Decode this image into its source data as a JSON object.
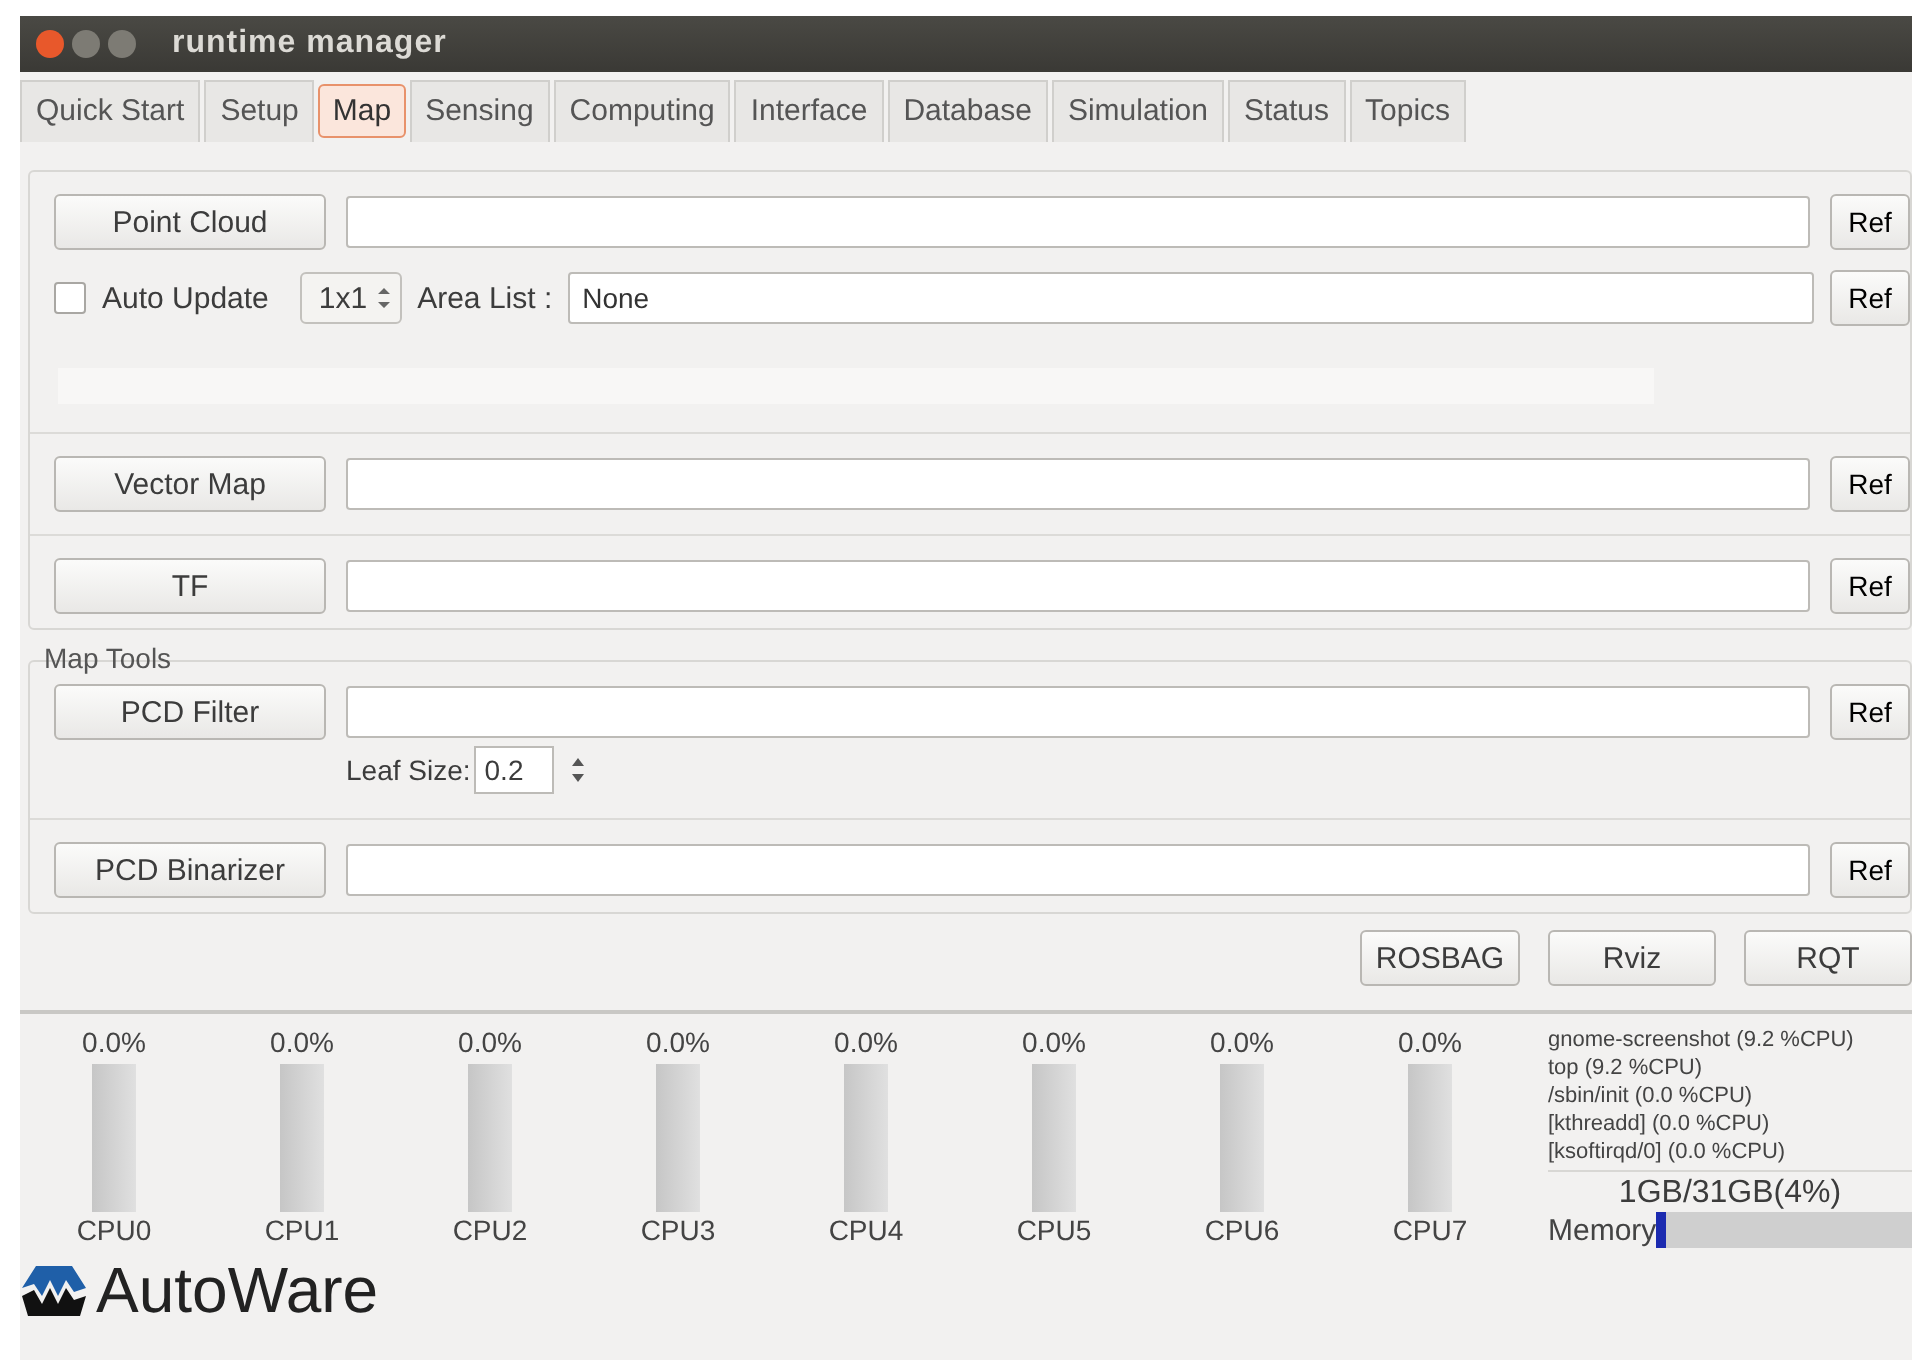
{
  "window": {
    "title": "runtime manager"
  },
  "tabs": [
    {
      "label": "Quick Start",
      "selected": false
    },
    {
      "label": "Setup",
      "selected": false
    },
    {
      "label": "Map",
      "selected": true
    },
    {
      "label": "Sensing",
      "selected": false
    },
    {
      "label": "Computing",
      "selected": false
    },
    {
      "label": "Interface",
      "selected": false
    },
    {
      "label": "Database",
      "selected": false
    },
    {
      "label": "Simulation",
      "selected": false
    },
    {
      "label": "Status",
      "selected": false
    },
    {
      "label": "Topics",
      "selected": false
    }
  ],
  "map_rows": [
    {
      "button": "Point Cloud",
      "ref": "Ref",
      "auto_update": {
        "label": "Auto Update",
        "checked": false
      },
      "grid": "1x1",
      "area_list": {
        "label": "Area List :",
        "value": "None",
        "ref": "Ref"
      },
      "progress": {
        "level": 0
      }
    },
    {
      "button": "Vector Map",
      "ref": "Ref"
    },
    {
      "button": "TF",
      "ref": "Ref"
    }
  ],
  "map_tools": {
    "title": "Map Tools",
    "rows": [
      {
        "button": "PCD Filter",
        "ref": "Ref",
        "leaf_size": {
          "label": "Leaf Size:",
          "value": "0.2"
        }
      },
      {
        "button": "PCD Binarizer",
        "ref": "Ref"
      }
    ]
  },
  "actions": [
    "ROSBAG",
    "Rviz",
    "RQT"
  ],
  "cpus": [
    {
      "reading": "0.0%",
      "level": 0,
      "name": "CPU0"
    },
    {
      "reading": "0.0%",
      "level": 0,
      "name": "CPU1"
    },
    {
      "reading": "0.0%",
      "level": 0,
      "name": "CPU2"
    },
    {
      "reading": "0.0%",
      "level": 0,
      "name": "CPU3"
    },
    {
      "reading": "0.0%",
      "level": 0,
      "name": "CPU4"
    },
    {
      "reading": "0.0%",
      "level": 0,
      "name": "CPU5"
    },
    {
      "reading": "0.0%",
      "level": 0,
      "name": "CPU6"
    },
    {
      "reading": "0.0%",
      "level": 0,
      "name": "CPU7"
    }
  ],
  "processes": [
    "gnome-screenshot (9.2 %CPU)",
    "top (9.2 %CPU)",
    "/sbin/init (0.0 %CPU)",
    "[kthreadd] (0.0 %CPU)",
    "[ksoftirqd/0] (0.0 %CPU)"
  ],
  "memory": {
    "reading": "1GB/31GB(4%)",
    "label": "Memory",
    "level": 0.04
  },
  "logo": {
    "text": "AutoWare"
  }
}
